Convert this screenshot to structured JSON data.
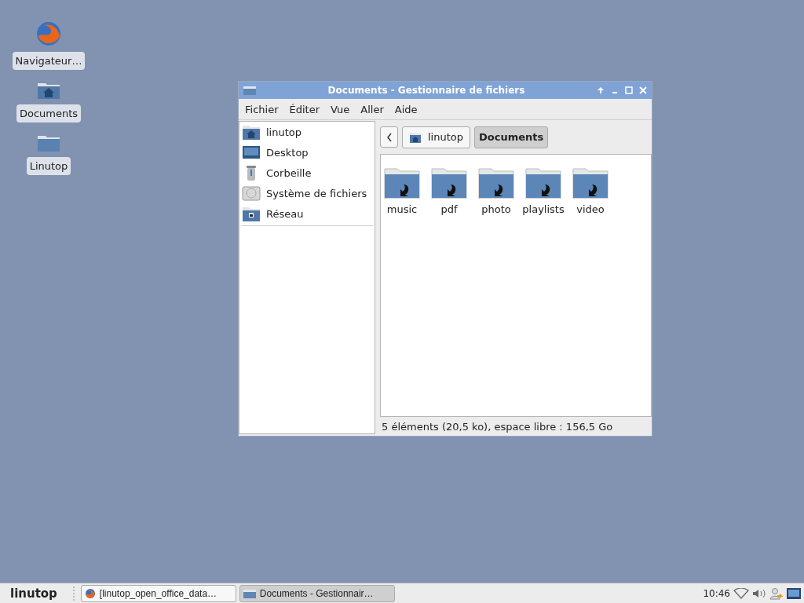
{
  "desktop_icons": [
    {
      "kind": "browser",
      "label": "Navigateur…"
    },
    {
      "kind": "home",
      "label": "Documents"
    },
    {
      "kind": "folder",
      "label": "Linutop"
    }
  ],
  "window": {
    "title": "Documents - Gestionnaire de fichiers",
    "menu": [
      "Fichier",
      "Éditer",
      "Vue",
      "Aller",
      "Aide"
    ],
    "sidebar": [
      {
        "kind": "home",
        "label": "linutop"
      },
      {
        "kind": "desktop",
        "label": "Desktop"
      },
      {
        "kind": "trash",
        "label": "Corbeille"
      },
      {
        "kind": "drive",
        "label": "Système de fichiers"
      },
      {
        "kind": "network",
        "label": "Réseau"
      }
    ],
    "path": [
      {
        "label": "linutop",
        "home": true,
        "selected": false
      },
      {
        "label": "Documents",
        "home": false,
        "selected": true
      }
    ],
    "files": [
      "music",
      "pdf",
      "photo",
      "playlists",
      "video"
    ],
    "status": "5 éléments (20,5 ko), espace libre : 156,5 Go"
  },
  "taskbar": {
    "logo": "linutop",
    "tasks": [
      {
        "kind": "browser",
        "label": "[linutop_open_office_data…",
        "selected": false
      },
      {
        "kind": "folder",
        "label": "Documents - Gestionnair…",
        "selected": true
      }
    ],
    "clock": "10:46"
  }
}
